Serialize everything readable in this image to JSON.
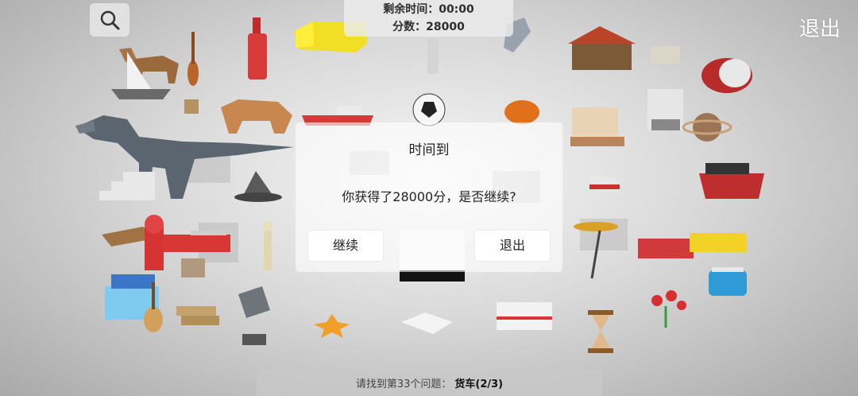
{
  "hud": {
    "time_label": "剩余时间：",
    "time_value": "00:00",
    "score_label": "分数：",
    "score_value": "28000"
  },
  "top_right": {
    "exit_label": "退出"
  },
  "dialog": {
    "title": "时间到",
    "message": "你获得了28000分，是否继续?",
    "continue_label": "继续",
    "exit_label": "退出"
  },
  "bottom_bar": {
    "prompt": "请找到第33个问题：",
    "target": "货车(2/3)"
  },
  "icons": {
    "search": "magnifier-icon"
  },
  "colors": {
    "hud_bg": "#ebebeb",
    "dialog_bg": "#ffffff",
    "exit_text": "#ffffff"
  }
}
